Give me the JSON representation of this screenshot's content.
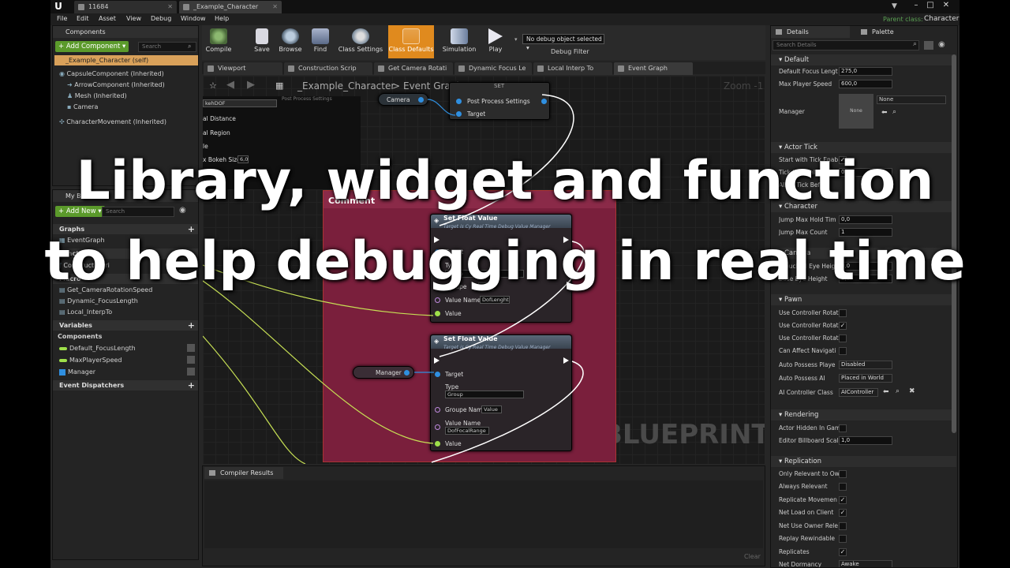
{
  "titlebar": {
    "tabs": [
      {
        "label": "11684"
      },
      {
        "label": "_Example_Character"
      }
    ],
    "minimize": "–",
    "maximize": "□",
    "close": "✕"
  },
  "menu": {
    "items": [
      "File",
      "Edit",
      "Asset",
      "View",
      "Debug",
      "Window",
      "Help"
    ],
    "parent_class_label": "Parent class:",
    "parent_class_value": "Character"
  },
  "components": {
    "tab": "Components",
    "add_button": "+ Add Component ▾",
    "search_placeholder": "Search",
    "self": "_Example_Character (self)",
    "items": [
      "CapsuleComponent (Inherited)",
      "ArrowComponent (Inherited)",
      "Mesh (Inherited)",
      "Camera",
      "CharacterMovement (Inherited)"
    ]
  },
  "my_blueprint": {
    "tab": "My Bluepr",
    "add_button": "+ Add New ▾",
    "search_placeholder": "Search",
    "graphs_label": "Graphs",
    "event_graph": "EventGraph",
    "functions_label": "Functi",
    "functions_extra": "ic)",
    "construction": "Constructi",
    "construction_tail": "Scri",
    "macros_label": "Macro",
    "macros": [
      "Get_CameraRotationSpeed",
      "Dynamic_FocusLength",
      "Local_InterpTo"
    ],
    "variables_label": "Variables",
    "components_label": "Components",
    "variables": [
      "Default_FocusLength",
      "MaxPlayerSpeed",
      "Manager"
    ],
    "event_dispatchers": "Event Dispatchers"
  },
  "toolbar": {
    "buttons": [
      {
        "label": "Compile"
      },
      {
        "label": "Save"
      },
      {
        "label": "Browse"
      },
      {
        "label": "Find"
      },
      {
        "label": "Class Settings"
      },
      {
        "label": "Class Defaults"
      },
      {
        "label": "Simulation"
      },
      {
        "label": "Play"
      }
    ],
    "debug_select": "No debug object selected ▾",
    "debug_filter": "Debug Filter"
  },
  "graph_tabs": [
    "Viewport",
    "Construction Scrip",
    "Get Camera Rotati",
    "Dynamic Focus Le",
    "Local Interp To",
    "Event Graph"
  ],
  "graph": {
    "breadcrumb_root": "_Example_Character",
    "breadcrumb_sep": ">",
    "breadcrumb_leaf": "Event Graph",
    "zoom": "Zoom -1",
    "watermark": "BLUEPRINT",
    "comment_label": "Comment",
    "set_node_title": "SET",
    "camera_pin": "Camera",
    "post_process": "Post Process Settings",
    "post_process_small": "Post Process Settings",
    "target": "Target",
    "left_panel": {
      "dropdown": "kehDOF",
      "items": [
        "al Distance",
        "al Region",
        "le",
        "x Bokeh Size"
      ],
      "bokeh_value": "6,0"
    },
    "node1": {
      "title": "Set Float Value",
      "subtitle": "Target is Cy Real Time Debug Value Manager",
      "target": "Target",
      "type": "Type",
      "type_value": "Group",
      "groupe_name": "Groupe",
      "groupe_value": "Val",
      "value_name": "Value Name",
      "value_name_val": "DofLenght",
      "value": "Value"
    },
    "node2": {
      "title": "Set Float Value",
      "subtitle": "Target is Cy Real Time Debug Value Manager",
      "target": "Target",
      "type": "Type",
      "type_value": "Group",
      "groupe_name": "Groupe Name",
      "groupe_value": "Value",
      "value_name": "Value Name",
      "value_name_val": "DofFocalRange",
      "value": "Value"
    },
    "manager_pin": "Manager"
  },
  "compiler": {
    "tab": "Compiler Results",
    "clear": "Clear"
  },
  "details": {
    "tab": "Details",
    "palette_tab": "Palette",
    "search_placeholder": "Search Details",
    "sections": {
      "default": "Default",
      "actor_tick": "Actor Tick",
      "character": "Character",
      "camera": "Camera",
      "pawn": "Pawn",
      "rendering": "Rendering",
      "replication": "Replication"
    },
    "default_rows": [
      {
        "label": "Default Focus Lengt",
        "value": "275,0"
      },
      {
        "label": "Max Player Speed",
        "value": "600,0"
      }
    ],
    "manager": {
      "label": "Manager",
      "thumb": "None",
      "value": "None"
    },
    "tick_rows": [
      {
        "label": "Start with Tick Enab",
        "value": "✓"
      },
      {
        "label": "Tick Interval (secs)",
        "value": "0,0"
      },
      {
        "label": "Allow Tick Before",
        "value": ""
      }
    ],
    "character_rows": [
      {
        "label": "Jump Max Hold Tim",
        "value": "0,0"
      },
      {
        "label": "Jump Max Count",
        "value": "1"
      }
    ],
    "camera_rows": [
      {
        "label": "Crouched Eye Heigh",
        "value": "0,0"
      },
      {
        "label": "Base Eye Height",
        "value": "0,0"
      }
    ],
    "pawn_rows": [
      {
        "label": "Use Controller Rotat",
        "value": ""
      },
      {
        "label": "Use Controller Rotat",
        "value": "✓"
      },
      {
        "label": "Use Controller Rotat",
        "value": ""
      },
      {
        "label": "Can Affect Navigati",
        "value": ""
      }
    ],
    "pawn_selects": [
      {
        "label": "Auto Possess Playe",
        "value": "Disabled"
      },
      {
        "label": "Auto Possess AI",
        "value": "Placed in World"
      },
      {
        "label": "AI Controller Class",
        "value": "AIController"
      }
    ],
    "rendering_rows": [
      {
        "label": "Actor Hidden In Gam",
        "value": ""
      },
      {
        "label": "Editor Billboard Scal",
        "value": "1,0"
      }
    ],
    "replication_rows": [
      {
        "label": "Only Relevant to Ow",
        "value": ""
      },
      {
        "label": "Always Relevant",
        "value": ""
      },
      {
        "label": "Replicate Movemen",
        "value": "✓"
      },
      {
        "label": "Net Load on Client",
        "value": "✓"
      },
      {
        "label": "Net Use Owner Rele",
        "value": ""
      },
      {
        "label": "Replay Rewindable",
        "value": ""
      },
      {
        "label": "Replicates",
        "value": "✓"
      },
      {
        "label": "Net Dormancy",
        "value": "Awake"
      }
    ]
  },
  "overlay": {
    "line1": "Library, widget and function",
    "line2": "to help debugging in real time"
  },
  "colors": {
    "accent": "#5b9a2b",
    "comment": "#7a1f3c",
    "exec": "#ffffff",
    "object_pin": "#2f8fe0",
    "float_pin": "#9ee04a"
  }
}
